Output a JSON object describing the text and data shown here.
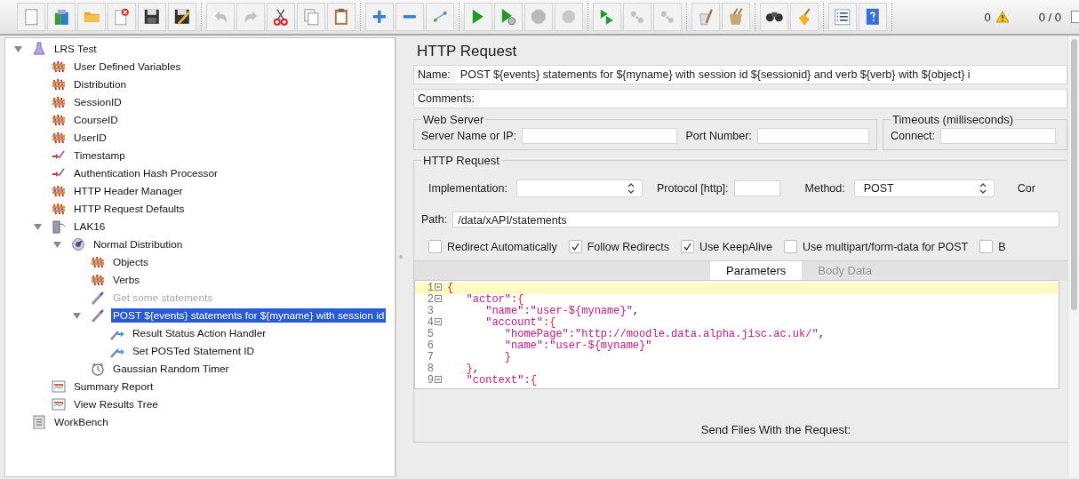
{
  "toolbar": {
    "groups": [
      [
        {
          "kind": "new",
          "disabled": false
        },
        {
          "kind": "templates",
          "disabled": false
        },
        {
          "kind": "open",
          "disabled": false
        },
        {
          "kind": "close",
          "disabled": false
        },
        {
          "kind": "save",
          "disabled": false
        },
        {
          "kind": "save_as",
          "disabled": false
        }
      ],
      [
        {
          "kind": "undo",
          "disabled": true
        },
        {
          "kind": "redo",
          "disabled": true
        },
        {
          "kind": "cut",
          "disabled": false
        },
        {
          "kind": "copy",
          "disabled": false
        },
        {
          "kind": "paste",
          "disabled": false
        }
      ],
      [
        {
          "kind": "expand",
          "disabled": false
        },
        {
          "kind": "collapse",
          "disabled": false
        },
        {
          "kind": "toggle",
          "disabled": false
        }
      ],
      [
        {
          "kind": "start",
          "disabled": false
        },
        {
          "kind": "start_no_pause",
          "disabled": false
        },
        {
          "kind": "stop",
          "disabled": true
        },
        {
          "kind": "shutdown",
          "disabled": true
        }
      ],
      [
        {
          "kind": "remote_start",
          "disabled": false
        },
        {
          "kind": "remote_stop",
          "disabled": true
        },
        {
          "kind": "remote_exit",
          "disabled": true
        }
      ],
      [
        {
          "kind": "clear",
          "disabled": false
        },
        {
          "kind": "clear_all",
          "disabled": false
        }
      ],
      [
        {
          "kind": "search",
          "disabled": false
        },
        {
          "kind": "reset_search",
          "disabled": false
        }
      ],
      [
        {
          "kind": "function_helper",
          "disabled": false
        },
        {
          "kind": "help",
          "disabled": false
        }
      ]
    ],
    "error_count": "0",
    "threads": "0 / 0"
  },
  "tree": [
    {
      "label": "LRS Test",
      "kind": "test_plan",
      "expanded": true,
      "selected": false,
      "disabled": false,
      "children": [
        {
          "label": "User Defined Variables",
          "kind": "config",
          "selected": false,
          "disabled": false
        },
        {
          "label": "Distribution",
          "kind": "config",
          "selected": false,
          "disabled": false
        },
        {
          "label": "SessionID",
          "kind": "config",
          "selected": false,
          "disabled": false
        },
        {
          "label": "CourseID",
          "kind": "config",
          "selected": false,
          "disabled": false
        },
        {
          "label": "UserID",
          "kind": "config",
          "selected": false,
          "disabled": false
        },
        {
          "label": "Timestamp",
          "kind": "preprocessor",
          "selected": false,
          "disabled": false
        },
        {
          "label": "Authentication Hash Processor",
          "kind": "preprocessor",
          "selected": false,
          "disabled": false
        },
        {
          "label": "HTTP Header Manager",
          "kind": "config",
          "selected": false,
          "disabled": false
        },
        {
          "label": "HTTP Request Defaults",
          "kind": "config",
          "selected": false,
          "disabled": false
        },
        {
          "label": "LAK16",
          "kind": "thread_group",
          "expanded": true,
          "selected": false,
          "disabled": false,
          "children": [
            {
              "label": "Normal Distribution",
              "kind": "controller",
              "expanded": true,
              "selected": false,
              "disabled": false,
              "children": [
                {
                  "label": "Objects",
                  "kind": "config",
                  "selected": false,
                  "disabled": false
                },
                {
                  "label": "Verbs",
                  "kind": "config",
                  "selected": false,
                  "disabled": false
                },
                {
                  "label": "Get some statements",
                  "kind": "sampler",
                  "selected": false,
                  "disabled": true
                },
                {
                  "label": "POST ${events} statements for ${myname} with session id",
                  "kind": "sampler",
                  "expanded": true,
                  "selected": true,
                  "disabled": false,
                  "children": [
                    {
                      "label": "Result Status Action Handler",
                      "kind": "postprocessor",
                      "selected": false,
                      "disabled": false
                    },
                    {
                      "label": "Set POSTed Statement ID",
                      "kind": "postprocessor",
                      "selected": false,
                      "disabled": false
                    }
                  ]
                },
                {
                  "label": "Gaussian Random Timer",
                  "kind": "timer",
                  "selected": false,
                  "disabled": false
                }
              ]
            }
          ]
        },
        {
          "label": "Summary Report",
          "kind": "listener",
          "selected": false,
          "disabled": false
        },
        {
          "label": "View Results Tree",
          "kind": "listener",
          "selected": false,
          "disabled": false
        }
      ]
    },
    {
      "label": "WorkBench",
      "kind": "workbench",
      "selected": false,
      "disabled": false
    }
  ],
  "panel": {
    "title": "HTTP Request",
    "name": {
      "label": "Name:",
      "value": "POST ${events} statements for ${myname} with session id ${sessionid} and verb ${verb} with ${object} i"
    },
    "comments": {
      "label": "Comments:"
    },
    "web_server": {
      "title": "Web Server",
      "server_label": "Server Name or IP:",
      "port_label": "Port Number:"
    },
    "timeouts": {
      "title": "Timeouts (milliseconds)",
      "connect_label": "Connect:"
    },
    "http_request": {
      "title": "HTTP Request",
      "implementation_label": "Implementation:",
      "protocol_label": "Protocol [http]:",
      "method_label": "Method:",
      "method_value": "POST",
      "column_5": "Cor",
      "path_label": "Path:",
      "path_value": "/data/xAPI/statements",
      "options": [
        {
          "label": "Redirect Automatically",
          "checked": false
        },
        {
          "label": "Follow Redirects",
          "checked": true
        },
        {
          "label": "Use KeepAlive",
          "checked": true
        },
        {
          "label": "Use multipart/form-data for POST",
          "checked": false
        },
        {
          "label": "B",
          "checked": false
        }
      ],
      "tabs": [
        {
          "label": "Parameters",
          "selected": true
        },
        {
          "label": "Body Data",
          "selected": false
        }
      ],
      "body_lines": [
        {
          "number": "1",
          "fold": true,
          "current": true,
          "segments": [
            {
              "kind": "brace",
              "text": "{"
            }
          ]
        },
        {
          "number": "2",
          "fold": true,
          "current": false,
          "segments": [
            {
              "kind": "string",
              "text": "   \"actor\":"
            },
            {
              "kind": "brace",
              "text": "{"
            }
          ]
        },
        {
          "number": "3",
          "fold": false,
          "current": false,
          "segments": [
            {
              "kind": "string",
              "text": "      \"name\":\"user-${myname}\""
            },
            {
              "kind": "plain",
              "text": ","
            }
          ]
        },
        {
          "number": "4",
          "fold": true,
          "current": false,
          "segments": [
            {
              "kind": "string",
              "text": "      \"account\":"
            },
            {
              "kind": "brace",
              "text": "{"
            }
          ]
        },
        {
          "number": "5",
          "fold": false,
          "current": false,
          "segments": [
            {
              "kind": "string",
              "text": "         \"homePage\":\"http://moodle.data.alpha.jisc.ac.uk/\""
            },
            {
              "kind": "plain",
              "text": ","
            }
          ]
        },
        {
          "number": "6",
          "fold": false,
          "current": false,
          "segments": [
            {
              "kind": "string",
              "text": "         \"name\":\"user-${myname}\""
            }
          ]
        },
        {
          "number": "7",
          "fold": false,
          "current": false,
          "segments": [
            {
              "kind": "brace",
              "text": "         }"
            }
          ]
        },
        {
          "number": "8",
          "fold": false,
          "current": false,
          "segments": [
            {
              "kind": "brace",
              "text": "   }"
            },
            {
              "kind": "plain",
              "text": ","
            }
          ]
        },
        {
          "number": "9",
          "fold": true,
          "current": false,
          "segments": [
            {
              "kind": "string",
              "text": "   \"context\":"
            },
            {
              "kind": "brace",
              "text": "{"
            }
          ]
        }
      ],
      "files_title": "Send Files With the Request:"
    }
  }
}
